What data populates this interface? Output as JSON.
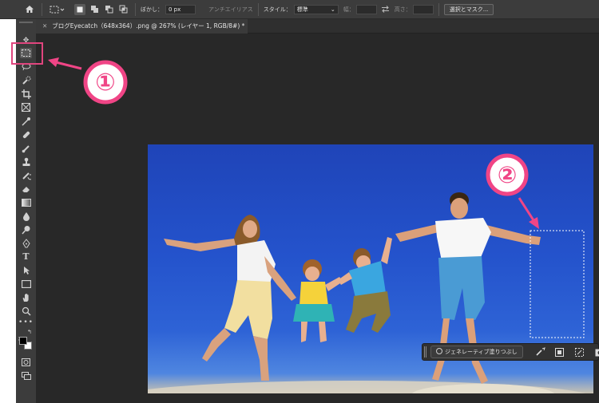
{
  "options_bar": {
    "feather_label": "ぼかし：",
    "feather_value": "0 px",
    "antialias_label": "アンチエイリアス",
    "style_label": "スタイル：",
    "style_value": "標準",
    "width_label": "幅：",
    "height_label": "高さ：",
    "select_mask_label": "選択とマスク..."
  },
  "document_tab": {
    "title": "ブログEyecatch（648x364）.png @ 267% (レイヤー 1, RGB/8#) *"
  },
  "callouts": {
    "one": "①",
    "two": "②"
  },
  "contextual_taskbar": {
    "generative_fill_label": "ジェネレーティブ塗りつぶし"
  },
  "colors": {
    "accent_callout": "#f04586",
    "selection_box_highlight": "#e0457e",
    "sky": "#2453cc"
  },
  "tools": [
    "move-icon",
    "marquee-icon",
    "lasso-icon",
    "quick-select-icon",
    "crop-icon",
    "frame-icon",
    "eyedropper-icon",
    "healing-brush-icon",
    "brush-icon",
    "clone-stamp-icon",
    "history-brush-icon",
    "eraser-icon",
    "gradient-icon",
    "blur-icon",
    "dodge-icon",
    "pen-icon",
    "type-icon",
    "path-select-icon",
    "rectangle-icon",
    "hand-icon",
    "zoom-icon",
    "more-tools-icon"
  ]
}
